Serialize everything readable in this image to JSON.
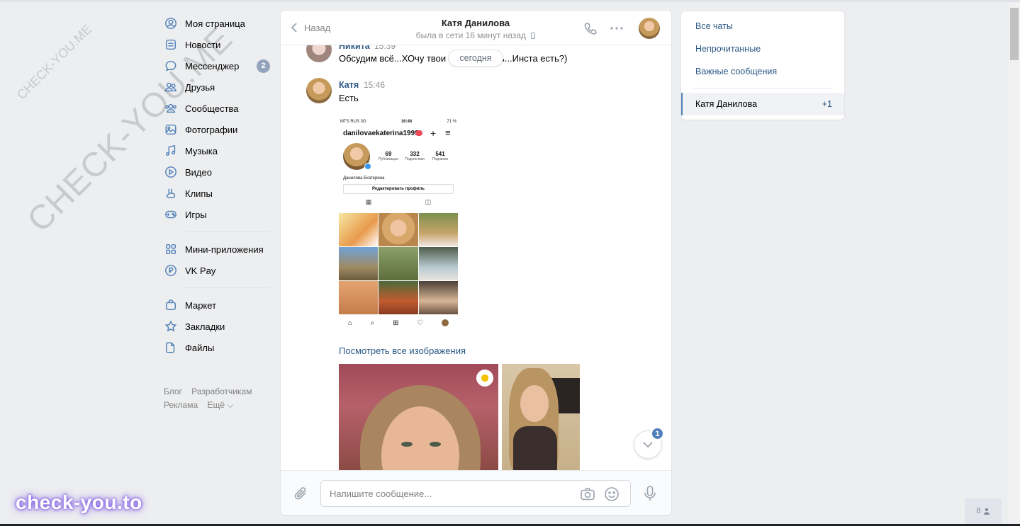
{
  "watermarks": {
    "small": "CHECK-YOU.ME",
    "large": "CHECK-YOU.ME",
    "brand": "check-you.to"
  },
  "nav": {
    "items": [
      {
        "label": "Моя страница",
        "icon": "user-circle-icon"
      },
      {
        "label": "Новости",
        "icon": "news-icon"
      },
      {
        "label": "Мессенджер",
        "icon": "messenger-icon",
        "badge": "2"
      },
      {
        "label": "Друзья",
        "icon": "friends-icon"
      },
      {
        "label": "Сообщества",
        "icon": "communities-icon"
      },
      {
        "label": "Фотографии",
        "icon": "photos-icon"
      },
      {
        "label": "Музыка",
        "icon": "music-icon"
      },
      {
        "label": "Видео",
        "icon": "video-icon"
      },
      {
        "label": "Клипы",
        "icon": "clips-icon"
      },
      {
        "label": "Игры",
        "icon": "games-icon"
      }
    ],
    "items2": [
      {
        "label": "Мини-приложения",
        "icon": "mini-apps-icon"
      },
      {
        "label": "VK Pay",
        "icon": "vkpay-icon"
      }
    ],
    "items3": [
      {
        "label": "Маркет",
        "icon": "market-icon"
      },
      {
        "label": "Закладки",
        "icon": "bookmarks-icon"
      },
      {
        "label": "Файлы",
        "icon": "files-icon"
      }
    ],
    "footer": {
      "blog": "Блог",
      "dev": "Разработчикам",
      "ads": "Реклама",
      "more": "Ещё ⌵"
    }
  },
  "chat": {
    "back_label": "Назад",
    "peer_name": "Катя Данилова",
    "peer_status": "была в сети 16 минут назад",
    "date_pill": "сегодня",
    "messages": [
      {
        "author": "Никита",
        "time": "15:39",
        "text_before": "Обсудим всё...ХОчу твои",
        "text_after": "ь...Инста есть?)"
      },
      {
        "author": "Катя",
        "time": "15:46",
        "text": "Есть"
      }
    ],
    "instagram": {
      "carrier": "MTS RUS 3G",
      "clock": "16:46",
      "battery": "71 %",
      "username": "danilovaekaterina1999",
      "dot_badge": "9+",
      "stats": [
        {
          "value": "69",
          "label": "Публикации"
        },
        {
          "value": "332",
          "label": "Подписчики"
        },
        {
          "value": "541",
          "label": "Подписки"
        }
      ],
      "full_name": "Данилова Екатерина",
      "edit_button": "Редактировать профиль"
    },
    "view_all_link": "Посмотреть все изображения",
    "scroll_badge": "1",
    "composer_placeholder": "Напишите сообщение..."
  },
  "right_panel": {
    "all_chats": "Все чаты",
    "unread": "Непрочитанные",
    "important": "Важные сообщения",
    "active_chat": "Катя Данилова",
    "active_count": "+1"
  },
  "friends_widget": {
    "count": "8"
  },
  "colors": {
    "accent": "#5181b8",
    "link": "#2a5885",
    "background": "#edeef0"
  }
}
